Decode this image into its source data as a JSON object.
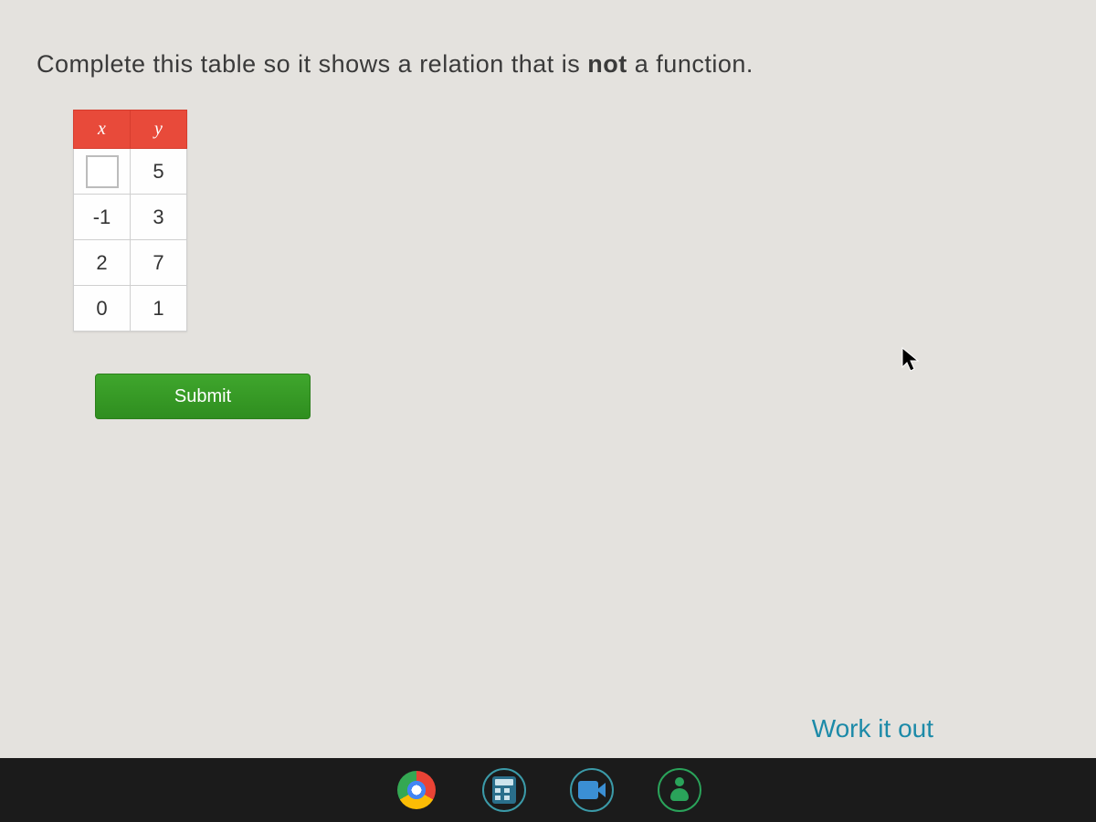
{
  "prompt": {
    "pre": "Complete this table so it shows a relation that is ",
    "bold": "not",
    "post": " a function."
  },
  "table": {
    "headers": {
      "x": "x",
      "y": "y"
    },
    "rows": [
      {
        "x": "",
        "y": "5",
        "xInput": true
      },
      {
        "x": "-1",
        "y": "3",
        "xInput": false
      },
      {
        "x": "2",
        "y": "7",
        "xInput": false
      },
      {
        "x": "0",
        "y": "1",
        "xInput": false
      }
    ]
  },
  "buttons": {
    "submit": "Submit"
  },
  "links": {
    "workItOut": "Work it out"
  },
  "shelfApps": {
    "chrome": "chrome",
    "calculator": "calculator",
    "video": "video",
    "account": "account"
  }
}
